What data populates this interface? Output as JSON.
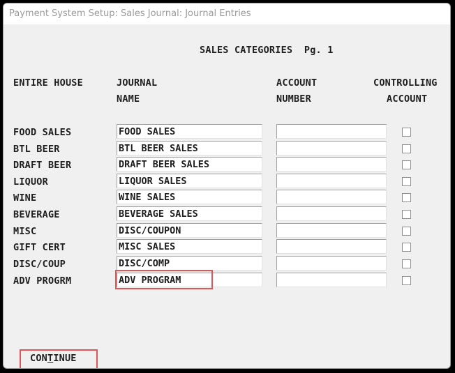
{
  "window": {
    "title": "Payment System Setup:  Sales Journal:  Journal Entries"
  },
  "heading": {
    "text": "SALES CATEGORIES  Pg. 1"
  },
  "columns": {
    "house": "ENTIRE HOUSE",
    "journal_line1": "JOURNAL",
    "journal_line2": "NAME",
    "account_line1": "ACCOUNT",
    "account_line2": "NUMBER",
    "controlling_line1": "CONTROLLING",
    "controlling_line2": "ACCOUNT"
  },
  "rows": [
    {
      "category": "FOOD SALES",
      "journal_name": "FOOD SALES",
      "account_number": "",
      "controlling": false
    },
    {
      "category": "BTL BEER",
      "journal_name": "BTL BEER SALES",
      "account_number": "",
      "controlling": false
    },
    {
      "category": "DRAFT BEER",
      "journal_name": "DRAFT BEER SALES",
      "account_number": "",
      "controlling": false
    },
    {
      "category": "LIQUOR",
      "journal_name": "LIQUOR SALES",
      "account_number": "",
      "controlling": false
    },
    {
      "category": "WINE",
      "journal_name": "WINE SALES",
      "account_number": "",
      "controlling": false
    },
    {
      "category": "BEVERAGE",
      "journal_name": "BEVERAGE SALES",
      "account_number": "",
      "controlling": false
    },
    {
      "category": "MISC",
      "journal_name": "DISC/COUPON",
      "account_number": "",
      "controlling": false
    },
    {
      "category": "GIFT CERT",
      "journal_name": "MISC SALES",
      "account_number": "",
      "controlling": false
    },
    {
      "category": "DISC/COUP",
      "journal_name": "DISC/COMP",
      "account_number": "",
      "controlling": false
    },
    {
      "category": "ADV PROGRM",
      "journal_name": "ADV PROGRAM",
      "account_number": "",
      "controlling": false
    }
  ],
  "continue_button": {
    "pre": "CON",
    "mnemonic": "T",
    "post": "INUE"
  },
  "colors": {
    "highlight": "#e05555",
    "background": "#f0f0f0",
    "text": "#1e1e1e"
  }
}
